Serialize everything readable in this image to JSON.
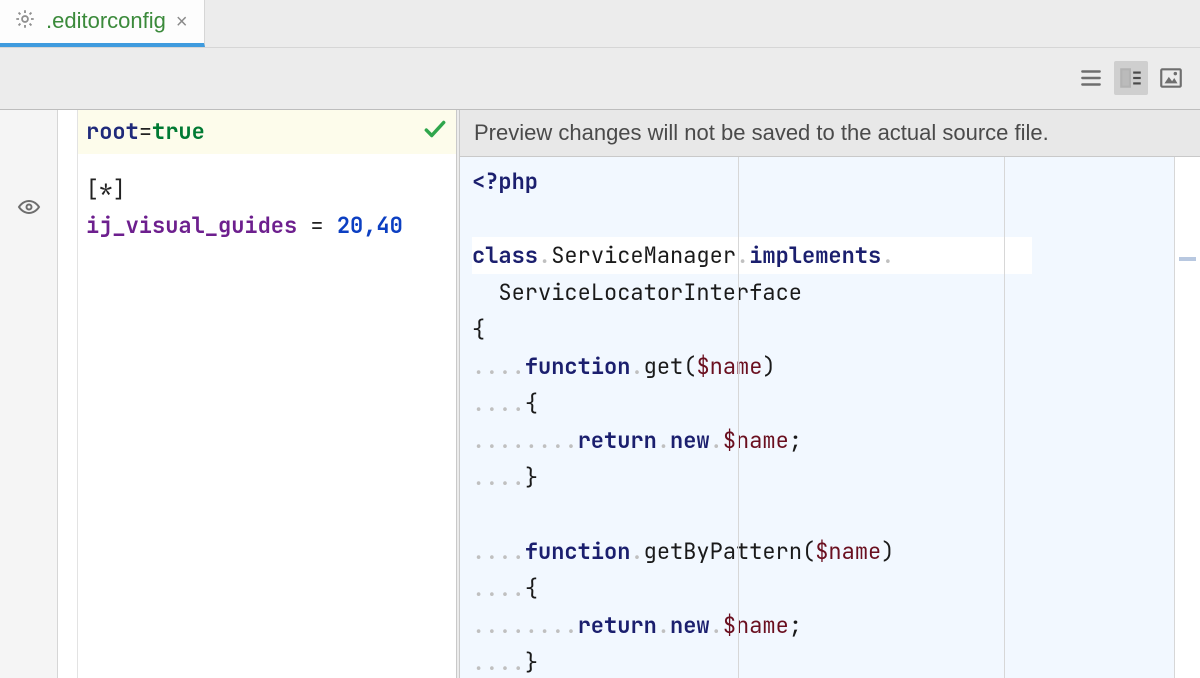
{
  "tab": {
    "label": ".editorconfig",
    "close_glyph": "×"
  },
  "toolbar": {
    "view_lines": "lines-view-icon",
    "view_split": "split-view-icon",
    "view_image": "image-view-icon",
    "active": "split"
  },
  "config": {
    "line1_key": "root",
    "line1_eq": " = ",
    "line1_val": "true",
    "section": "[*]",
    "prop_key": "ij_visual_guides",
    "prop_eq": " = ",
    "prop_val": "20,40",
    "check_title": "no-problems"
  },
  "preview": {
    "notice": "Preview changes will not be saved to the actual source file.",
    "guides": [
      20,
      40
    ],
    "scroll_marker_offset_px": 100,
    "code": {
      "open_tag": "<?php",
      "class_kw": "class",
      "class_name": "ServiceManager",
      "implements_kw": "implements",
      "iface": "ServiceLocatorInterface",
      "brace_open": "{",
      "func_kw": "function",
      "return_kw": "return",
      "new_kw": "new",
      "var": "$name",
      "fn1_name": "get",
      "fn2_name": "getByPattern",
      "brace_close": "}"
    }
  }
}
